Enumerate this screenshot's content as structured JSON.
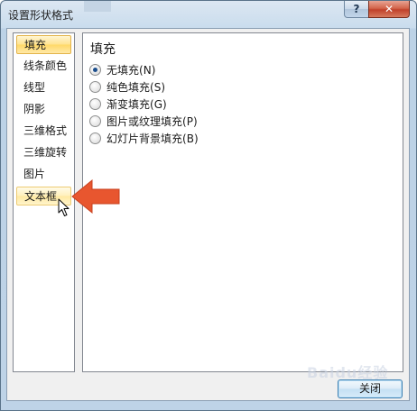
{
  "window": {
    "title": "设置形状格式",
    "help_label": "?",
    "close_label": "✕"
  },
  "nav": {
    "items": [
      {
        "label": "填充",
        "state": "selected"
      },
      {
        "label": "线条颜色",
        "state": "normal"
      },
      {
        "label": "线型",
        "state": "normal"
      },
      {
        "label": "阴影",
        "state": "normal"
      },
      {
        "label": "三维格式",
        "state": "normal"
      },
      {
        "label": "三维旋转",
        "state": "normal"
      },
      {
        "label": "图片",
        "state": "normal"
      },
      {
        "label": "文本框",
        "state": "hover"
      }
    ]
  },
  "content": {
    "section_title": "填充",
    "options": [
      {
        "label": "无填充",
        "key": "N",
        "checked": true
      },
      {
        "label": "纯色填充",
        "key": "S",
        "checked": false
      },
      {
        "label": "渐变填充",
        "key": "G",
        "checked": false
      },
      {
        "label": "图片或纹理填充",
        "key": "P",
        "checked": false
      },
      {
        "label": "幻灯片背景填充",
        "key": "B",
        "checked": false
      }
    ]
  },
  "footer": {
    "close_button_label": "关闭"
  },
  "annotation": {
    "arrow_color": "#e8562f",
    "arrow_icon": "left-arrow-icon",
    "cursor_icon": "mouse-pointer-icon"
  },
  "watermark": {
    "text": "Baidu经验"
  }
}
